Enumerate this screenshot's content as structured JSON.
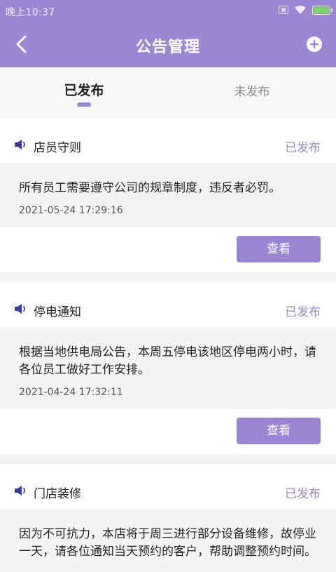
{
  "status_bar": {
    "time": "晚上10:37"
  },
  "header": {
    "title": "公告管理",
    "back_icon": "back-chevron-icon",
    "add_icon": "add-circle-icon"
  },
  "tabs": [
    {
      "label": "已发布",
      "active": true
    },
    {
      "label": "未发布",
      "active": false
    }
  ],
  "colors": {
    "accent": "#9a86d2",
    "speaker": "#3b3ba8"
  },
  "announcements": [
    {
      "title": "店员守则",
      "status": "已发布",
      "content": "所有员工需要遵守公司的规章制度，违反者必罚。",
      "time": "2021-05-24 17:29:16",
      "button": "查看"
    },
    {
      "title": "停电通知",
      "status": "已发布",
      "content": "根据当地供电局公告，本周五停电该地区停电两小时，请各位员工做好工作安排。",
      "time": "2021-04-24 17:32:11",
      "button": "查看"
    },
    {
      "title": "门店装修",
      "status": "已发布",
      "content": "因为不可抗力，本店将于周三进行部分设备维修，故停业一天，请各位通知当天预约的客户，帮助调整预约时间。"
    }
  ]
}
